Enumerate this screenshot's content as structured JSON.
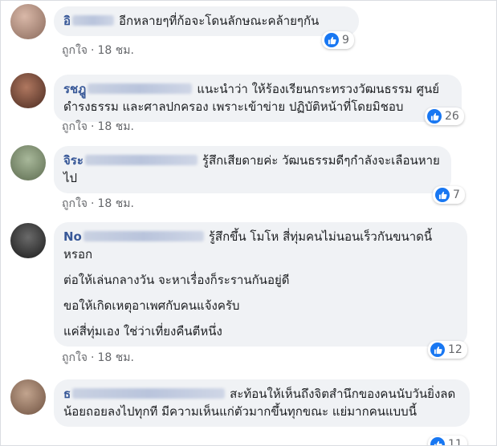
{
  "comments": [
    {
      "author": "อิ",
      "text": "อีกหลายๆที่ก้อจะโดนลักษณะคล้ายๆกัน",
      "paragraphs": [],
      "reactions": "9",
      "like_label": "ถูกใจ",
      "time": "18 ชม."
    },
    {
      "author": "รชฎู",
      "text": "แนะนำว่า ให้ร้องเรียนกระทรวงวัฒนธรรม ศูนย์ดำรงธรรม และศาลปกครอง เพราะเข้าข่าย ปฏิบัติหน้าที่โดยมิชอบ",
      "paragraphs": [],
      "reactions": "26",
      "like_label": "ถูกใจ",
      "time": "18 ชม."
    },
    {
      "author": "จิระ",
      "text": "รู้สึกเสียดายค่ะ วัฒนธรรมดีๆกำลังจะเลือนหายไป",
      "paragraphs": [],
      "reactions": "7",
      "like_label": "ถูกใจ",
      "time": "18 ชม."
    },
    {
      "author": "No",
      "text": "รู้สึกขึ้น โมโห สี่ทุ่มคนไม่นอนเร็วกันขนาดนี้หรอก",
      "paragraphs": [
        "ต่อให้เล่นกลางวัน จะหาเรื่องก็ระรานกันอยู่ดี",
        "ขอให้เกิดเหตุอาเพศกับคนแจ้งครับ",
        "แค่สี่ทุ่มเอง ใช่ว่าเที่ยงคืนตีหนึ่ง"
      ],
      "reactions": "12",
      "like_label": "ถูกใจ",
      "time": "18 ชม."
    },
    {
      "author": "ธ",
      "text": "สะท้อนให้เห็นถึงจิตสำนึกของคนนับวันยิ่งลดน้อยถอยลงไปทุกที มีความเห็นแก่ตัวมากขึ้นทุกขณะ แย่มากคนแบบนี้",
      "paragraphs": [],
      "reactions": "11",
      "like_label": "",
      "time": ""
    }
  ],
  "colors": {
    "bubble": "#f0f2f5",
    "author": "#385898",
    "meta": "#65676b",
    "like_badge": "#1877f2"
  },
  "icons": {
    "reaction": "thumbs-up-icon"
  }
}
